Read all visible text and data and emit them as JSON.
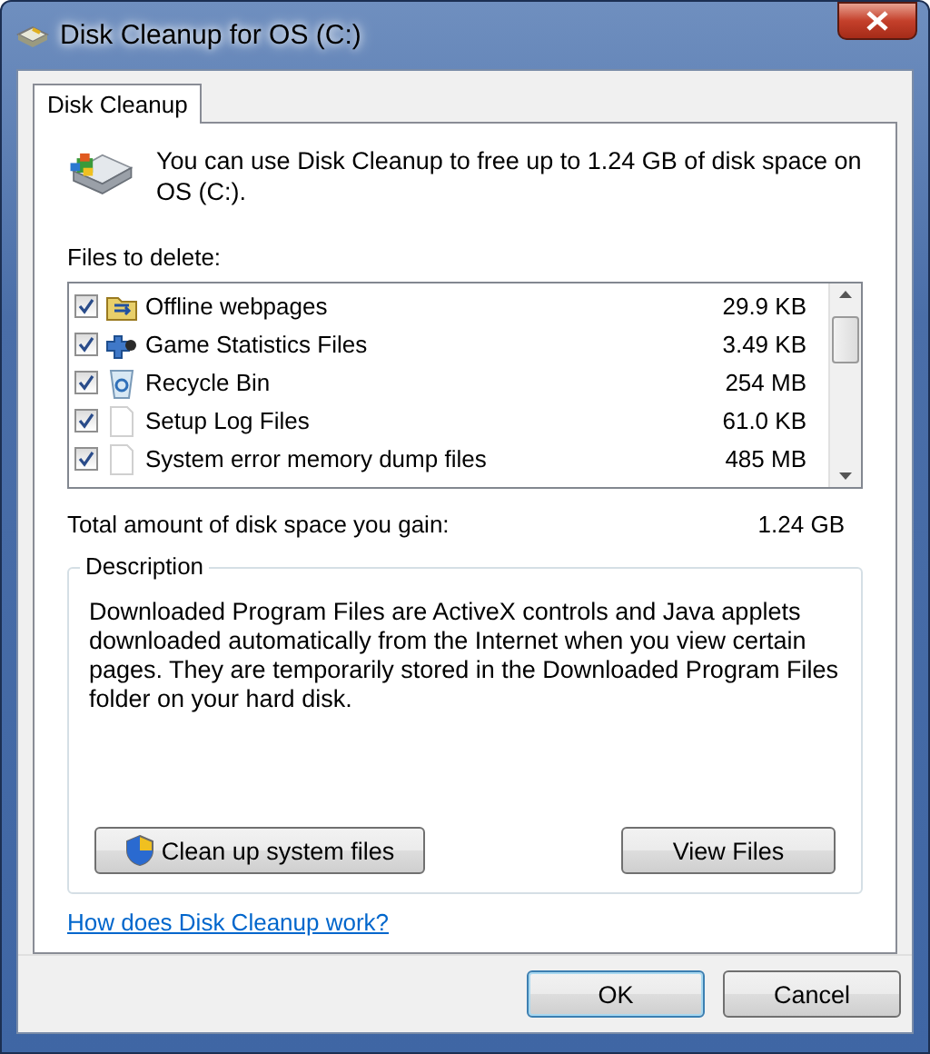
{
  "window": {
    "title": "Disk Cleanup for OS (C:)"
  },
  "tabs": [
    {
      "label": "Disk Cleanup",
      "selected": true
    }
  ],
  "intro": "You can use Disk Cleanup to free up to 1.24 GB of disk space on OS (C:).",
  "files_label": "Files to delete:",
  "files": [
    {
      "name": "Offline webpages",
      "size": "29.9 KB",
      "checked": true,
      "kind": "folder"
    },
    {
      "name": "Game Statistics Files",
      "size": "3.49 KB",
      "checked": true,
      "kind": "game"
    },
    {
      "name": "Recycle Bin",
      "size": "254 MB",
      "checked": true,
      "kind": "bin"
    },
    {
      "name": "Setup Log Files",
      "size": "61.0 KB",
      "checked": true,
      "kind": "document"
    },
    {
      "name": "System error memory dump files",
      "size": "485 MB",
      "checked": true,
      "kind": "document"
    }
  ],
  "total": {
    "label": "Total amount of disk space you gain:",
    "value": "1.24 GB"
  },
  "description": {
    "title": "Description",
    "text": "Downloaded Program Files are ActiveX controls and Java applets downloaded automatically from the Internet when you view certain pages. They are temporarily stored in the Downloaded Program Files folder on your hard disk."
  },
  "actions": [
    {
      "label": "Clean up system files",
      "kind": "shield"
    },
    {
      "label": "View Files",
      "kind": "plain"
    }
  ],
  "help_link": "How does Disk Cleanup work?",
  "buttons": [
    {
      "label": "OK",
      "selected": true
    },
    {
      "label": "Cancel",
      "selected": false
    }
  ]
}
